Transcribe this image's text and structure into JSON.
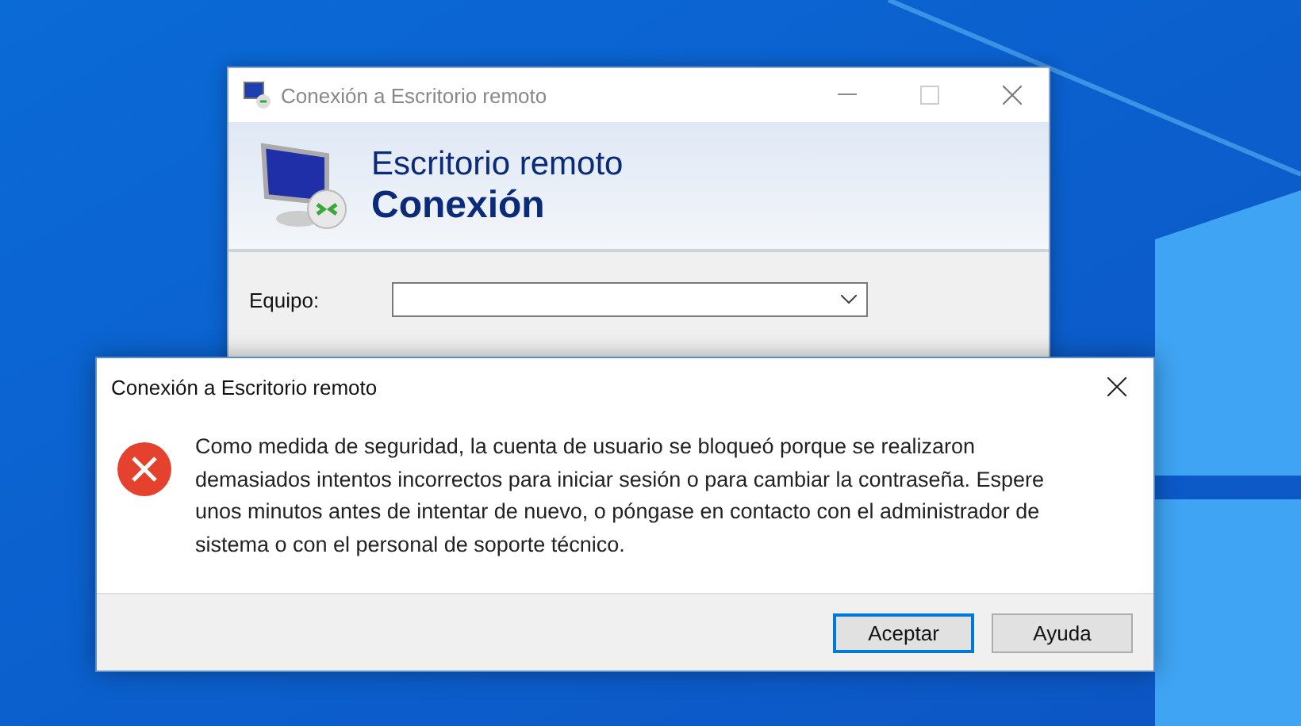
{
  "main_window": {
    "title": "Conexión a Escritorio remoto",
    "banner_line_1": "Escritorio remoto",
    "banner_line_2": "Conexión",
    "fields": [
      {
        "label": "Equipo:"
      }
    ]
  },
  "dialog": {
    "title": "Conexión a Escritorio remoto",
    "kind": "error",
    "message": "Como medida de seguridad, la cuenta de usuario se bloqueó porque se realizaron demasiados intentos incorrectos para iniciar sesión o para cambiar la contraseña. Espere unos minutos antes de intentar de nuevo, o póngase en contacto con el administrador de sistema o con el personal de soporte técnico.",
    "buttons": [
      {
        "label": "Aceptar",
        "default": true
      },
      {
        "label": "Ayuda",
        "default": false
      }
    ]
  }
}
